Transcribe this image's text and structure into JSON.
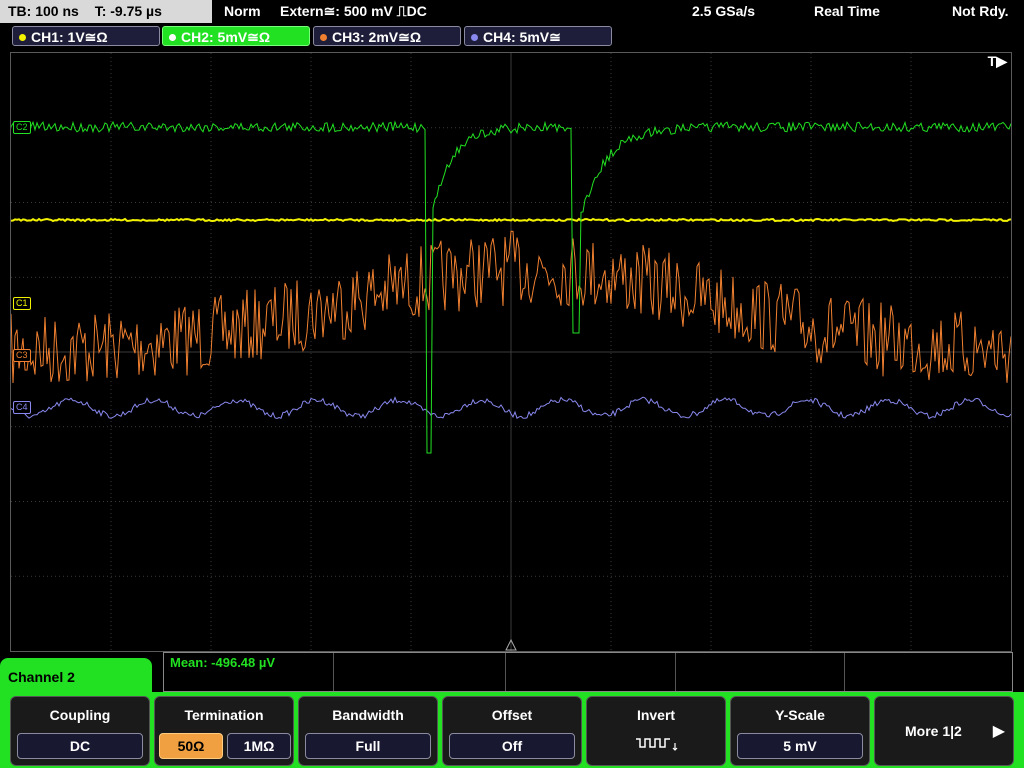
{
  "top": {
    "tb": "TB: 100 ns",
    "t": "T: -9.75 µs",
    "mode": "Norm",
    "trigger": "Extern≅: 500 mV ⎍DC",
    "rate": "2.5 GSa/s",
    "acq": "Real Time",
    "status": "Not Rdy."
  },
  "channels": [
    {
      "label": "CH1: 1V≅Ω",
      "color": "#f2f200"
    },
    {
      "label": "CH2: 5mV≅Ω",
      "color": "#22e022"
    },
    {
      "label": "CH3: 2mV≅Ω",
      "color": "#f08030"
    },
    {
      "label": "CH4: 5mV≅",
      "color": "#8888ee"
    }
  ],
  "markers": {
    "c1": "C1",
    "c2": "C2",
    "c3": "C3",
    "c4": "C4"
  },
  "trigger_marker": "T▶",
  "measurement": {
    "mean": "Mean: -496.48 µV"
  },
  "menu": {
    "channel_label": "Channel 2",
    "coupling": {
      "title": "Coupling",
      "value": "DC"
    },
    "termination": {
      "title": "Termination",
      "opt1": "50Ω",
      "opt2": "1MΩ"
    },
    "bandwidth": {
      "title": "Bandwidth",
      "value": "Full"
    },
    "offset": {
      "title": "Offset",
      "value": "Off"
    },
    "invert": {
      "title": "Invert"
    },
    "yscale": {
      "title": "Y-Scale",
      "value": "5 mV"
    },
    "more": {
      "title": "More 1|2",
      "arrow": "▶"
    }
  },
  "colors": {
    "ch1": "#f2f200",
    "ch2": "#22e022",
    "ch3": "#f08030",
    "ch4": "#8888ee",
    "grid": "#3a3a3a"
  }
}
